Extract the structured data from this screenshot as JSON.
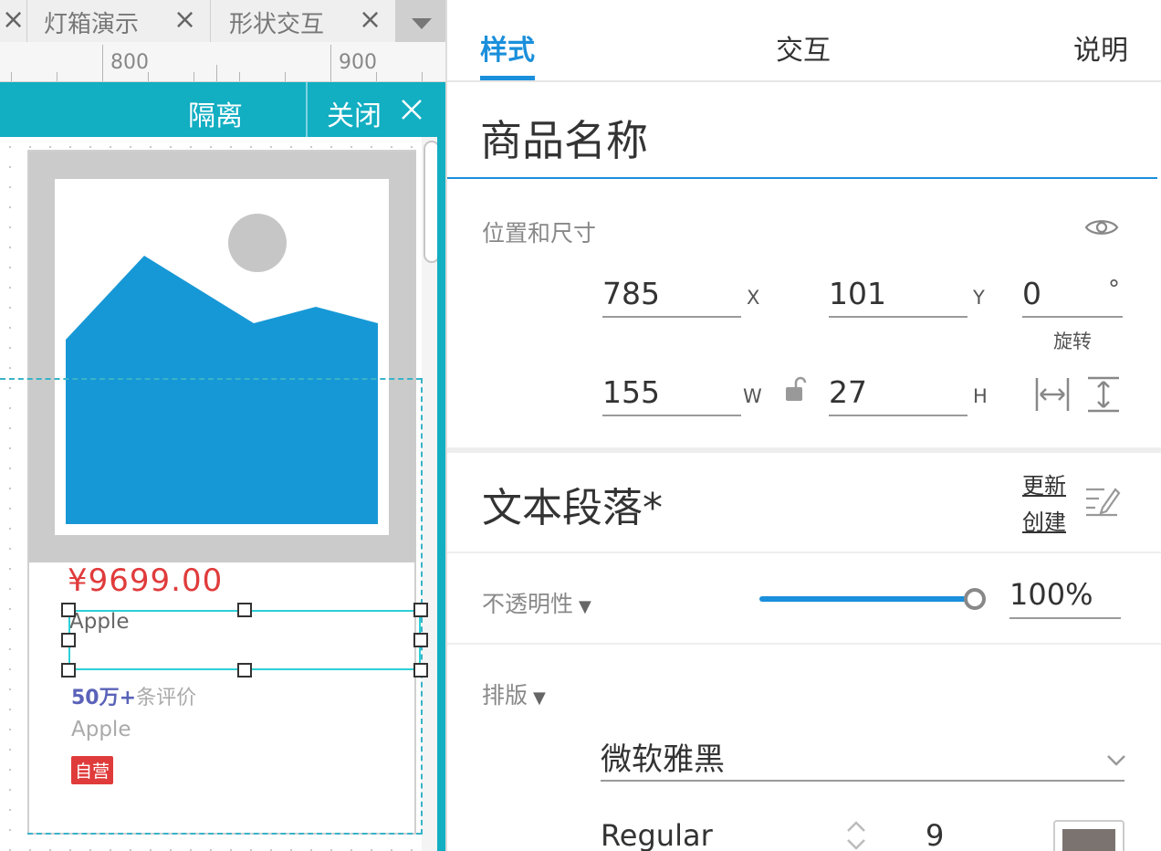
{
  "tabs": [
    {
      "label": "灯箱演示",
      "close": "×"
    },
    {
      "label": "形状交互",
      "close": "×"
    }
  ],
  "ruler": {
    "marks": [
      "800",
      "900"
    ]
  },
  "isolate_bar": {
    "isolate_label": "隔离",
    "close_label": "关闭"
  },
  "product": {
    "price": "¥9699.00",
    "name": "Apple",
    "reviews_count": "50万+",
    "reviews_suffix": "条评价",
    "shop": "Apple",
    "badge": "自营"
  },
  "panel": {
    "tabs": {
      "style": "样式",
      "interaction": "交互",
      "notes": "说明"
    },
    "widget_name": "商品名称",
    "position_size": {
      "title": "位置和尺寸",
      "x": "785",
      "x_label": "X",
      "y": "101",
      "y_label": "Y",
      "rotation": "0",
      "rotation_unit": "°",
      "rotation_label": "旋转",
      "w": "155",
      "w_label": "W",
      "h": "27",
      "h_label": "H"
    },
    "style_name": "文本段落*",
    "update_link": "更新",
    "create_link": "创建",
    "opacity": {
      "label": "不透明性",
      "value": "100%",
      "level": 1.0
    },
    "typography": {
      "label": "排版",
      "font": "微软雅黑",
      "weight": "Regular",
      "size": "9"
    }
  },
  "colors": {
    "accent": "#1a8fdb",
    "teal": "#12aec2",
    "image_blue": "#1798d6",
    "price_red": "#e03b3b",
    "badge_red": "#e03b3b",
    "text_color_swatch": "#7a7370"
  }
}
